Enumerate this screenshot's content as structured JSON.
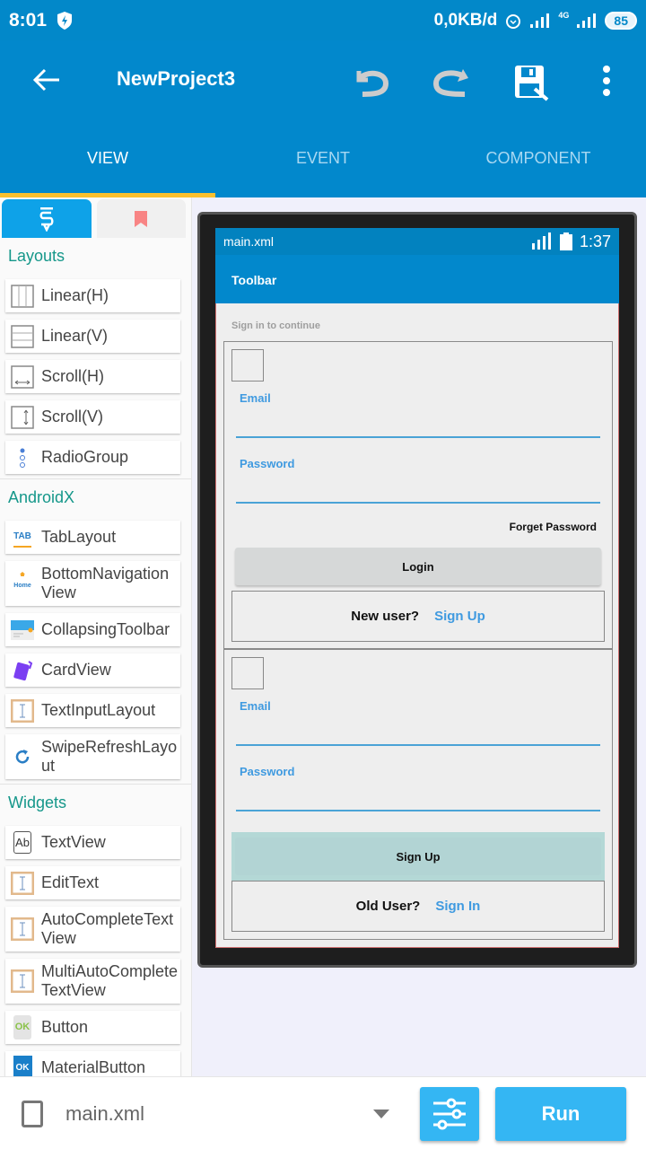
{
  "status_bar": {
    "time": "8:01",
    "net_speed": "0,0KB/d",
    "network_label": "4G",
    "battery": "85"
  },
  "app_bar": {
    "title": "NewProject3"
  },
  "tabs": [
    {
      "label": "VIEW",
      "active": true
    },
    {
      "label": "EVENT",
      "active": false
    },
    {
      "label": "COMPONENT",
      "active": false
    }
  ],
  "colors": {
    "primary": "#0288cc",
    "tab_indicator": "#fbc02d",
    "section": "#15978a",
    "accent": "#34b6f3",
    "link": "#3f9ae0"
  },
  "palette": {
    "sections": [
      {
        "title": "Layouts",
        "items": [
          {
            "label": "Linear(H)",
            "icon": "linear-h-icon"
          },
          {
            "label": "Linear(V)",
            "icon": "linear-v-icon"
          },
          {
            "label": "Scroll(H)",
            "icon": "scroll-h-icon"
          },
          {
            "label": "Scroll(V)",
            "icon": "scroll-v-icon"
          },
          {
            "label": "RadioGroup",
            "icon": "radiogroup-icon"
          }
        ]
      },
      {
        "title": "AndroidX",
        "items": [
          {
            "label": "TabLayout",
            "icon": "tab-icon",
            "icon_text": "TAB"
          },
          {
            "label": "BottomNavigation View",
            "icon": "home-icon",
            "icon_text": "Home"
          },
          {
            "label": "CollapsingToolbar",
            "icon": "collapsing-toolbar-icon"
          },
          {
            "label": "CardView",
            "icon": "cardview-icon"
          },
          {
            "label": "TextInputLayout",
            "icon": "text-input-icon"
          },
          {
            "label": "SwipeRefreshLayo ut",
            "icon": "refresh-icon"
          }
        ]
      },
      {
        "title": "Widgets",
        "items": [
          {
            "label": "TextView",
            "icon": "textview-icon",
            "icon_text": "Ab"
          },
          {
            "label": "EditText",
            "icon": "edittext-icon"
          },
          {
            "label": "AutoCompleteText View",
            "icon": "edittext-icon"
          },
          {
            "label": "MultiAutoComplete TextView",
            "icon": "edittext-icon"
          },
          {
            "label": "Button",
            "icon": "button-icon",
            "icon_text": "OK"
          },
          {
            "label": "MaterialButton",
            "icon": "material-button-icon",
            "icon_text": "OK"
          }
        ]
      }
    ]
  },
  "preview": {
    "file": "main.xml",
    "time": "1:37",
    "toolbar": "Toolbar",
    "subtitle": "Sign in to continue",
    "login_card": {
      "email_label": "Email",
      "password_label": "Password",
      "forget": "Forget Password",
      "button": "Login",
      "prompt": "New user?",
      "link": "Sign Up"
    },
    "signup_card": {
      "email_label": "Email",
      "password_label": "Password",
      "button": "Sign Up",
      "prompt": "Old User?",
      "link": "Sign In"
    }
  },
  "bottom_bar": {
    "file": "main.xml",
    "run_label": "Run"
  }
}
